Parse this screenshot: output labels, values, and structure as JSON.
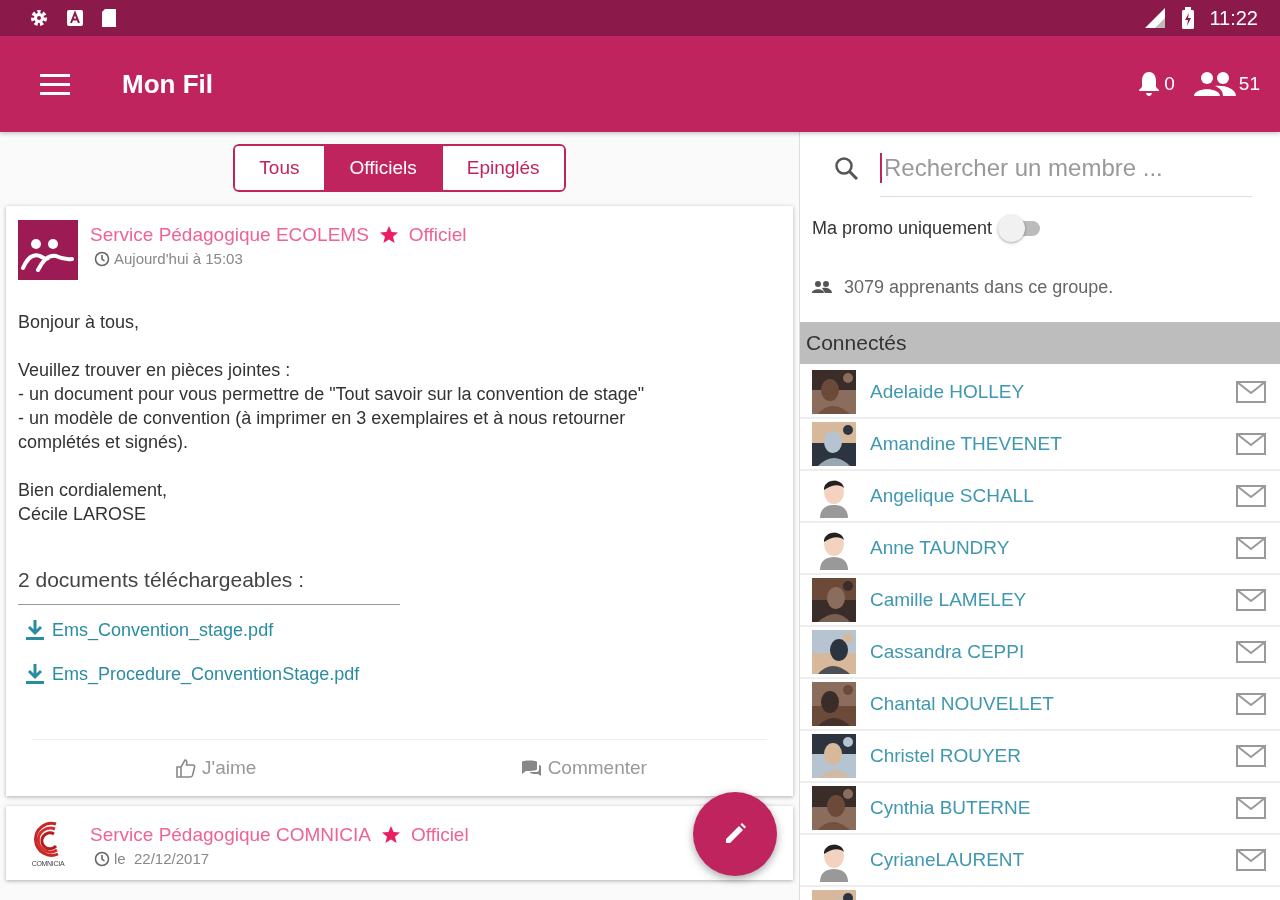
{
  "status_bar": {
    "time": "11:22"
  },
  "app_bar": {
    "title": "Mon Fil",
    "notifications": "0",
    "members": "51"
  },
  "tabs": [
    {
      "label": "Tous",
      "selected": false
    },
    {
      "label": "Officiels",
      "selected": true
    },
    {
      "label": "Epinglés",
      "selected": false
    }
  ],
  "posts": [
    {
      "logo": {
        "kind": "ecolems"
      },
      "author": "Service Pédagogique ECOLEMS",
      "badge": "Officiel",
      "date": "Aujourd'hui à 15:03",
      "body": [
        "Bonjour à tous,",
        "Veuillez trouver en pièces jointes :\n- un document pour vous permettre de \"Tout savoir sur la convention de stage\"\n- un modèle de convention (à imprimer en 3 exemplaires et à nous retourner\ncomplétés et signés).",
        "Bien cordialement,\nCécile LAROSE"
      ],
      "documents_title": "2 documents téléchargeables :",
      "documents": [
        "Ems_Convention_stage.pdf",
        "Ems_Procedure_ConventionStage.pdf"
      ],
      "like": "J'aime",
      "comment": "Commenter"
    },
    {
      "logo": {
        "kind": "comnicia",
        "text": "COMNICIA"
      },
      "author": "Service Pédagogique COMNICIA",
      "badge": "Officiel",
      "date": "le  22/12/2017"
    }
  ],
  "member_panel": {
    "search": {
      "placeholder": "Rechercher un membre ..."
    },
    "promo_filter": {
      "label": "Ma promo uniquement",
      "on": false
    },
    "count": "3079 apprenants dans ce groupe.",
    "section": "Connectés",
    "members": [
      {
        "name": "Adelaide HOLLEY"
      },
      {
        "name": "Amandine THEVENET"
      },
      {
        "name": "Angelique SCHALL",
        "kind": "default"
      },
      {
        "name": "Anne TAUNDRY",
        "kind": "default"
      },
      {
        "name": "Camille LAMELEY"
      },
      {
        "name": "Cassandra CEPPI"
      },
      {
        "name": "Chantal NOUVELLET"
      },
      {
        "name": "Christel ROUYER"
      },
      {
        "name": "Cynthia BUTERNE"
      },
      {
        "name": "CyrianeLAURENT",
        "kind": "default"
      }
    ]
  }
}
